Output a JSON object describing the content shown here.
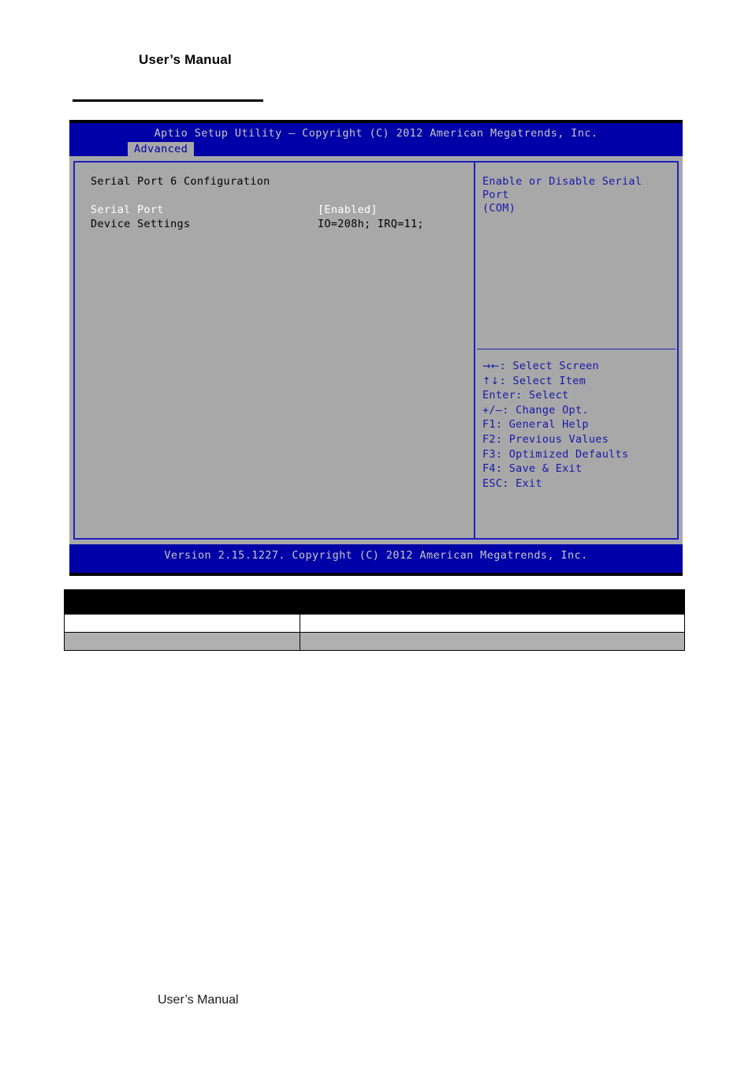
{
  "document": {
    "header_title": "User’s Manual",
    "footer_title": "User’s Manual"
  },
  "bios": {
    "title": "Aptio Setup Utility – Copyright (C) 2012 American Megatrends, Inc.",
    "active_tab": "Advanced",
    "version_bar": "Version 2.15.1227. Copyright (C) 2012 American Megatrends, Inc.",
    "section_title": "Serial Port 6 Configuration",
    "options": [
      {
        "label": "Serial Port",
        "value": "[Enabled]",
        "selected": true
      },
      {
        "label": "Device Settings",
        "value": "IO=208h; IRQ=11;",
        "selected": false
      }
    ],
    "help": {
      "line1": "Enable or Disable Serial Port",
      "line2": "(COM)"
    },
    "nav_keys": [
      {
        "glyph": "→←",
        "text": ": Select Screen"
      },
      {
        "glyph": "↑↓",
        "text": ": Select Item"
      },
      {
        "glyph": "",
        "text": "Enter: Select"
      },
      {
        "glyph": "",
        "text": "+/–: Change Opt."
      },
      {
        "glyph": "",
        "text": "F1: General Help"
      },
      {
        "glyph": "",
        "text": "F2: Previous Values"
      },
      {
        "glyph": "",
        "text": "F3: Optimized Defaults"
      },
      {
        "glyph": "",
        "text": "F4: Save & Exit"
      },
      {
        "glyph": "",
        "text": "ESC: Exit"
      }
    ],
    "colors": {
      "chrome_blue": "#0000a8",
      "panel_gray": "#a8a8a8",
      "border_blue": "#2020c0",
      "help_text_blue": "#1818a8",
      "title_text": "#c6c6c6",
      "selected_text": "#ffffff"
    }
  },
  "table": {
    "rows": [
      {
        "style": "hdr",
        "cells": [
          "",
          ""
        ]
      },
      {
        "style": "white",
        "cells": [
          "",
          ""
        ]
      },
      {
        "style": "gray",
        "cells": [
          "",
          ""
        ]
      }
    ]
  }
}
